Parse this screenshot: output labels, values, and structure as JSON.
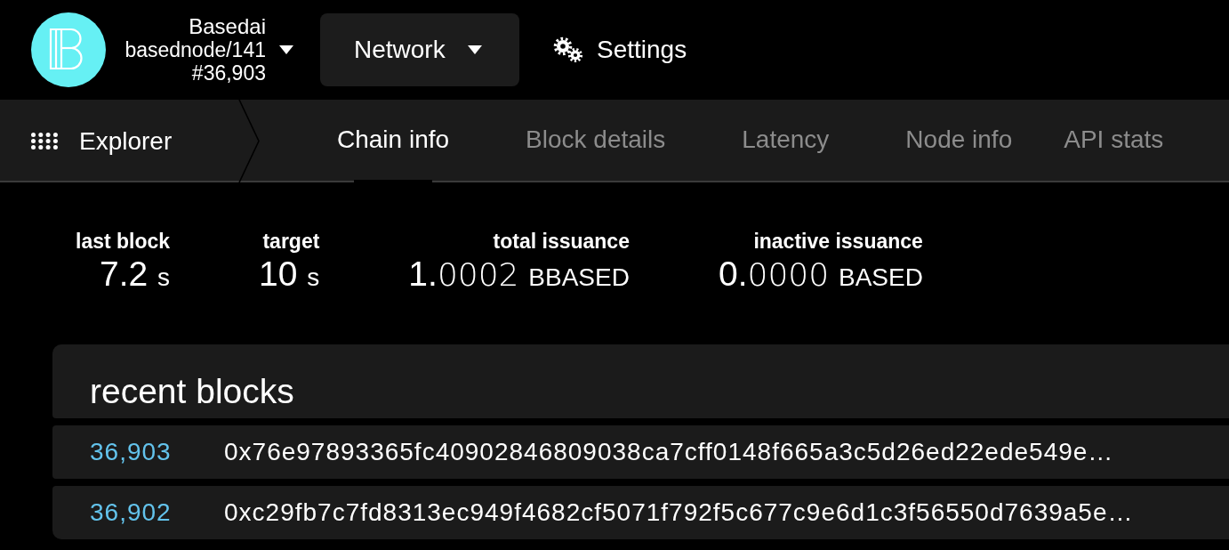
{
  "node": {
    "chain": "Basedai",
    "name": "basednode/141",
    "block": "#36,903"
  },
  "menu": [
    {
      "label": "Network",
      "kind": "dropdown"
    },
    {
      "label": "Settings",
      "kind": "link"
    }
  ],
  "section": {
    "label": "Explorer"
  },
  "tabs": [
    {
      "label": "Chain info",
      "selected": true
    },
    {
      "label": "Block details",
      "selected": false
    },
    {
      "label": "Latency",
      "selected": false
    },
    {
      "label": "Node info",
      "selected": false
    },
    {
      "label": "API stats",
      "selected": false
    }
  ],
  "stats": [
    {
      "label": "last block",
      "value": "7.2",
      "unit": "s"
    },
    {
      "label": "target",
      "value": "10",
      "unit": "s"
    },
    {
      "label": "total issuance",
      "value": "1.",
      "decimals": "0002",
      "unit": "BBASED"
    },
    {
      "label": "inactive issuance",
      "value": "0.",
      "decimals": "0000",
      "unit": "BASED"
    }
  ],
  "recent_blocks": {
    "title": "recent blocks",
    "rows": [
      {
        "number": "36,903",
        "hash": "0x76e97893365fc40902846809038ca7cff0148f665a3c5d26ed22ede549e…"
      },
      {
        "number": "36,902",
        "hash": "0xc29fb7c7fd8313ec949f4682cf5071f792f5c677c9e6d1c3f56550d7639a5e…"
      }
    ]
  }
}
